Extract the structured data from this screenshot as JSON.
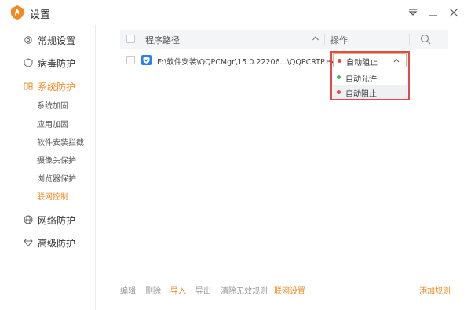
{
  "window": {
    "title": "设置"
  },
  "colors": {
    "accent": "#f08a24",
    "red_dot": "#e54848",
    "green_dot": "#4cb85a"
  },
  "sidebar": {
    "items": [
      {
        "label": "常规设置",
        "icon": "gear-icon"
      },
      {
        "label": "病毒防护",
        "icon": "shield-icon"
      },
      {
        "label": "系统防护",
        "icon": "system-icon"
      },
      {
        "label": "网络防护",
        "icon": "globe-icon"
      },
      {
        "label": "高级防护",
        "icon": "diamond-icon"
      }
    ],
    "subitems": [
      "系统加固",
      "应用加固",
      "软件安装拦截",
      "摄像头保护",
      "浏览器保护",
      "联网控制"
    ]
  },
  "table": {
    "col_path": "程序路径",
    "col_action": "操作",
    "rows": [
      {
        "path": "E:\\软件安装\\QQPCMgr\\15.0.22206...\\QQPCRTP.exe",
        "action": "自动阻止"
      }
    ]
  },
  "dropdown": {
    "selected": "自动阻止",
    "options": [
      "自动允许",
      "自动阻止"
    ]
  },
  "bottom": {
    "edit": "编辑",
    "delete": "删除",
    "import": "导入",
    "export": "导出",
    "clear_invalid": "清除无效规则",
    "network_settings": "联网设置",
    "add_rule": "添加规则"
  }
}
